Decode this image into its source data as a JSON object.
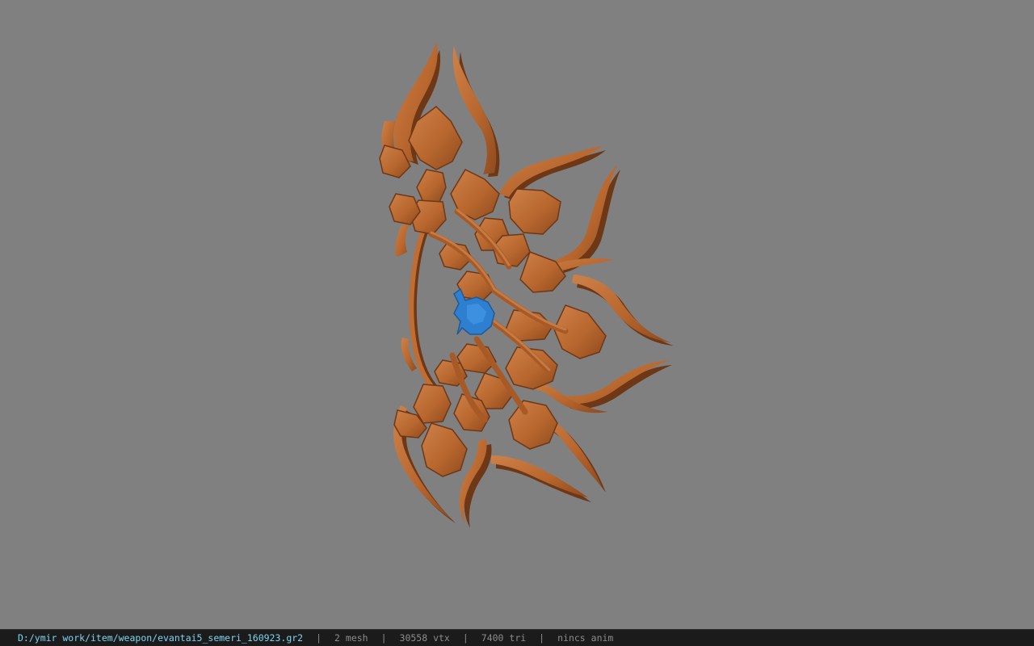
{
  "viewport": {
    "background": "#808080",
    "model_color": "#b8672e",
    "model_shadow": "#6e3716",
    "model_highlight": "#cf8450",
    "attachment_color": "#2f7fd0"
  },
  "status_bar": {
    "file_path": "D:/ymir work/item/weapon/evantai5_semeri_160923.gr2",
    "mesh": "2 mesh",
    "vertices": "30558 vtx",
    "triangles": "7400 tri",
    "animation": "nincs anim",
    "separator": "|"
  }
}
